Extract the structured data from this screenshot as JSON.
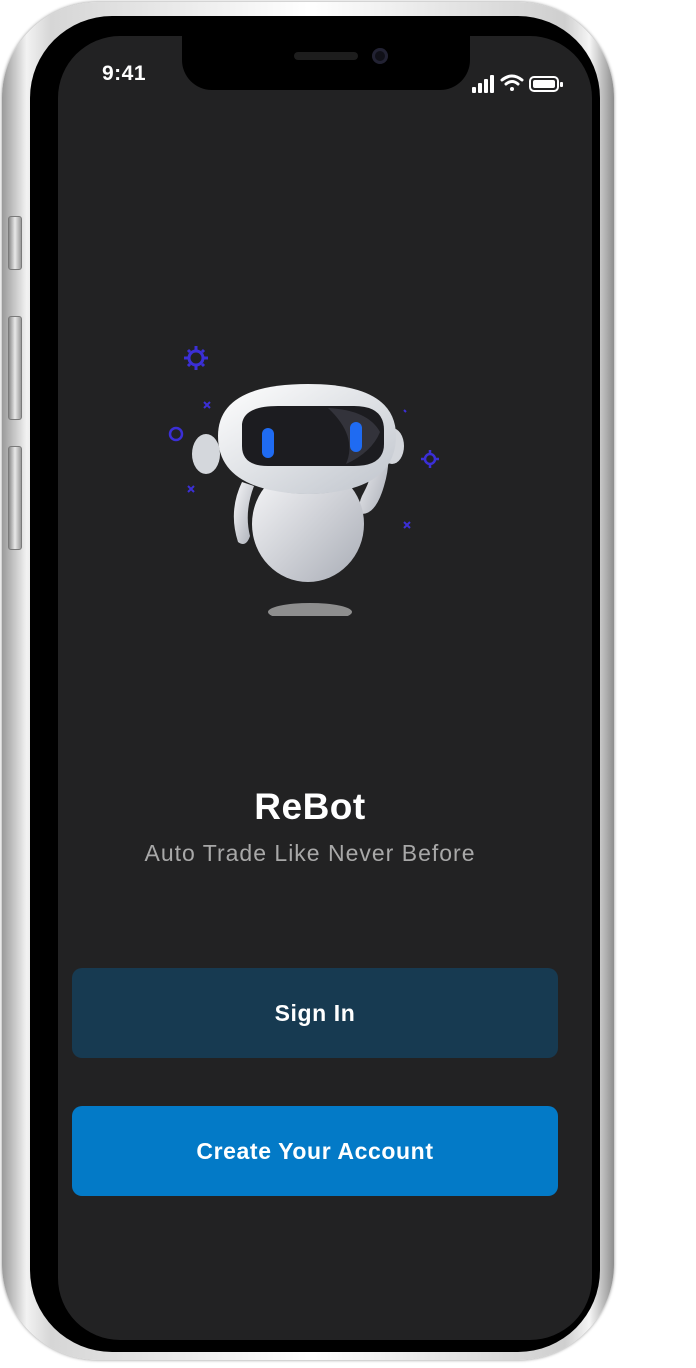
{
  "status_bar": {
    "time": "9:41"
  },
  "brand": {
    "title": "ReBot",
    "subtitle": "Auto Trade Like Never Before"
  },
  "actions": {
    "sign_in_label": "Sign In",
    "create_account_label": "Create Your Account"
  },
  "colors": {
    "screen_background": "#222223",
    "sign_in_button": "#173a51",
    "create_account_button": "#037ac7",
    "subtitle_text": "#a8a8a8",
    "accent_decor": "#3b2fd6",
    "robot_eye": "#1f6bf2"
  },
  "icons": {
    "status": [
      "cellular-signal-icon",
      "wifi-icon",
      "battery-icon"
    ],
    "decor": [
      "gear-icon",
      "ring-icon",
      "sparkle-icon"
    ]
  }
}
